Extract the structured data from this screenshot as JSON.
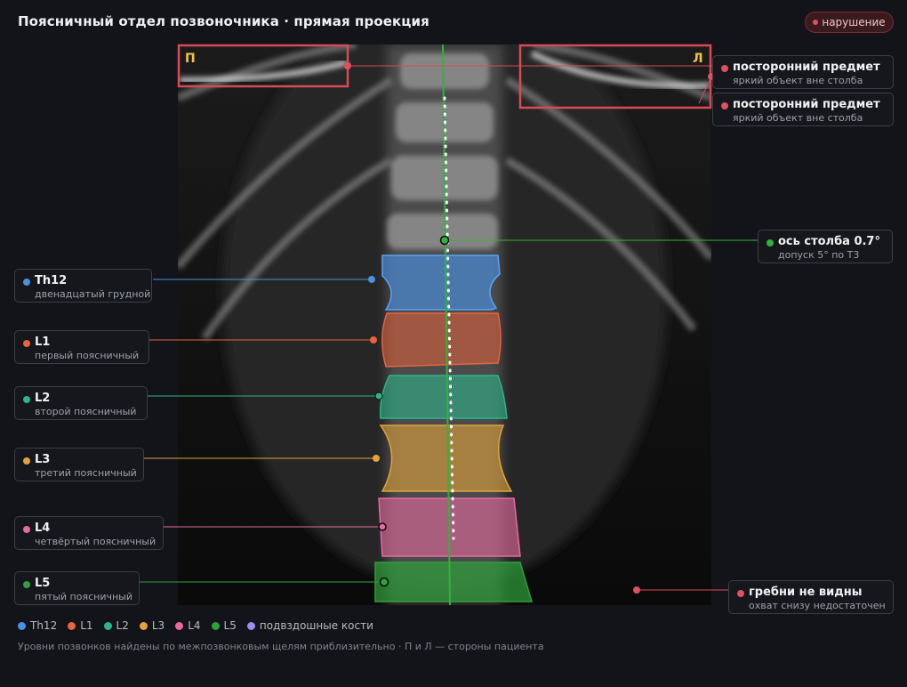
{
  "header": {
    "title": "Поясничный отдел позвоночника · прямая проекция",
    "status_badge": "нарушение"
  },
  "sides": {
    "right": "П",
    "left": "Л"
  },
  "vertebrae": [
    {
      "id": "th12",
      "name": "Th12",
      "desc": "двенадцатый грудной",
      "color": "#4a90e2"
    },
    {
      "id": "l1",
      "name": "L1",
      "desc": "первый поясничный",
      "color": "#e8643c"
    },
    {
      "id": "l2",
      "name": "L2",
      "desc": "второй поясничный",
      "color": "#2fb38a"
    },
    {
      "id": "l3",
      "name": "L3",
      "desc": "третий поясничный",
      "color": "#e2a33a"
    },
    {
      "id": "l4",
      "name": "L4",
      "desc": "четвёртый поясничный",
      "color": "#e86aa0"
    },
    {
      "id": "l5",
      "name": "L5",
      "desc": "пятый поясничный",
      "color": "#2fa03a"
    }
  ],
  "findings": {
    "foreign_1": {
      "title": "посторонний предмет",
      "desc": "яркий объект вне столба",
      "color": "#e0505e"
    },
    "foreign_2": {
      "title": "посторонний предмет",
      "desc": "яркий объект вне столба",
      "color": "#e0505e"
    },
    "axis": {
      "title": "ось столба 0.7°",
      "desc": "допуск 5° по Т3",
      "color": "#2fb33a"
    },
    "crests": {
      "title": "гребни не видны",
      "desc": "охват снизу недостаточен",
      "color": "#e0505e"
    }
  },
  "legend": [
    {
      "label": "Th12",
      "color": "#4a90e2"
    },
    {
      "label": "L1",
      "color": "#e8643c"
    },
    {
      "label": "L2",
      "color": "#2fb38a"
    },
    {
      "label": "L3",
      "color": "#e2a33a"
    },
    {
      "label": "L4",
      "color": "#e86aa0"
    },
    {
      "label": "L5",
      "color": "#2fa03a"
    },
    {
      "label": "подвздошные кости",
      "color": "#9a8cf0"
    }
  ],
  "footnote": "Уровни позвонков найдены по межпозвонковым щелям приблизительно · П и Л — стороны пациента"
}
